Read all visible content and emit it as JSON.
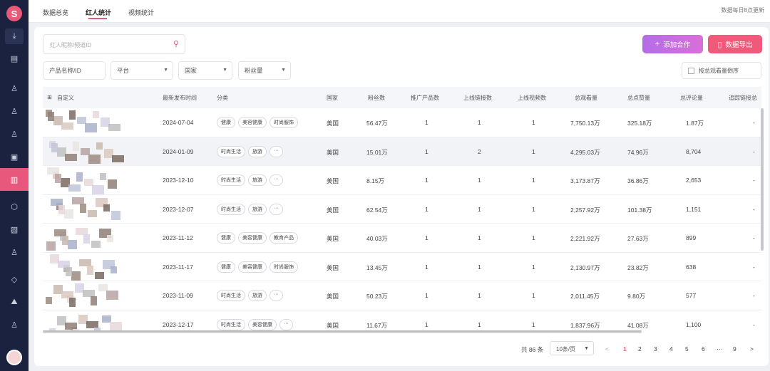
{
  "sidebar": {
    "logo_text": "S",
    "icons": [
      "download-icon",
      "report-icon",
      "user-icon",
      "users-icon",
      "user-star-icon",
      "wallet-icon",
      "creator-stats-icon",
      "box-icon",
      "gallery-icon",
      "person-upload-icon",
      "diamond-icon",
      "chart-mountain-icon",
      "profile-icon"
    ]
  },
  "tabs": [
    {
      "label": "数据总览"
    },
    {
      "label": "红人统计"
    },
    {
      "label": "视频统计"
    }
  ],
  "update_note": "数据每日8点更新",
  "search": {
    "placeholder": "红人昵称/频道ID"
  },
  "buttons": {
    "add": "添加合作",
    "export": "数据导出"
  },
  "filters": {
    "product": "产品名称/ID",
    "platform": "平台",
    "country": "国家",
    "fans": "粉丝量",
    "sort_toggle": "按总观看量倒序"
  },
  "table": {
    "headers": [
      "自定义",
      "最新发布时间",
      "分类",
      "国家",
      "粉丝数",
      "推广产品数",
      "上线链接数",
      "上线视频数",
      "总观看量",
      "总点赞量",
      "总评论量",
      "追踪链接总"
    ],
    "rows": [
      {
        "date": "2024-07-04",
        "tags": [
          "健康",
          "美容健康",
          "时尚服饰"
        ],
        "country": "美国",
        "fans": "56.47万",
        "products": "1",
        "links": "1",
        "videos": "1",
        "views": "7,750.13万",
        "likes": "325.18万",
        "comments": "1.87万",
        "track": "-"
      },
      {
        "date": "2024-01-09",
        "tags": [
          "时尚生活",
          "旅游",
          "···"
        ],
        "country": "美国",
        "fans": "15.01万",
        "products": "1",
        "links": "2",
        "videos": "1",
        "views": "4,295.03万",
        "likes": "74.96万",
        "comments": "8,704",
        "track": "-"
      },
      {
        "date": "2023-12-10",
        "tags": [
          "时尚生活",
          "旅游",
          "···"
        ],
        "country": "美国",
        "fans": "8.15万",
        "products": "1",
        "links": "1",
        "videos": "1",
        "views": "3,173.87万",
        "likes": "36.86万",
        "comments": "2,653",
        "track": "-"
      },
      {
        "date": "2023-12-07",
        "tags": [
          "时尚生活",
          "旅游",
          "···"
        ],
        "country": "美国",
        "fans": "62.54万",
        "products": "1",
        "links": "1",
        "videos": "1",
        "views": "2,257.92万",
        "likes": "101.38万",
        "comments": "1,151",
        "track": "-"
      },
      {
        "date": "2023-11-12",
        "tags": [
          "健康",
          "美容健康",
          "教育产品"
        ],
        "country": "美国",
        "fans": "40.03万",
        "products": "1",
        "links": "1",
        "videos": "1",
        "views": "2,221.92万",
        "likes": "27.63万",
        "comments": "899",
        "track": "-"
      },
      {
        "date": "2023-11-17",
        "tags": [
          "健康",
          "美容健康",
          "时尚服饰"
        ],
        "country": "美国",
        "fans": "13.45万",
        "products": "1",
        "links": "1",
        "videos": "1",
        "views": "2,130.97万",
        "likes": "23.82万",
        "comments": "638",
        "track": "-"
      },
      {
        "date": "2023-11-09",
        "tags": [
          "时尚生活",
          "旅游",
          "···"
        ],
        "country": "美国",
        "fans": "50.23万",
        "products": "1",
        "links": "1",
        "videos": "1",
        "views": "2,011.45万",
        "likes": "9.80万",
        "comments": "577",
        "track": "-"
      },
      {
        "date": "2023-12-17",
        "tags": [
          "时尚生活",
          "美容健康",
          "···"
        ],
        "country": "美国",
        "fans": "11.67万",
        "products": "1",
        "links": "1",
        "videos": "1",
        "views": "1,837.96万",
        "likes": "41.08万",
        "comments": "1,100",
        "track": "-"
      }
    ]
  },
  "pagination": {
    "total": "共 86 条",
    "page_size": "10条/页",
    "prev": "<",
    "pages": [
      "1",
      "2",
      "3",
      "4",
      "5",
      "6",
      "···",
      "9"
    ],
    "next": ">",
    "current": "1"
  },
  "colors": {
    "accent": "#e8577c",
    "sidebar": "#1a2240",
    "add_button": "#c56fe0",
    "export_button": "#ef5a7a"
  }
}
